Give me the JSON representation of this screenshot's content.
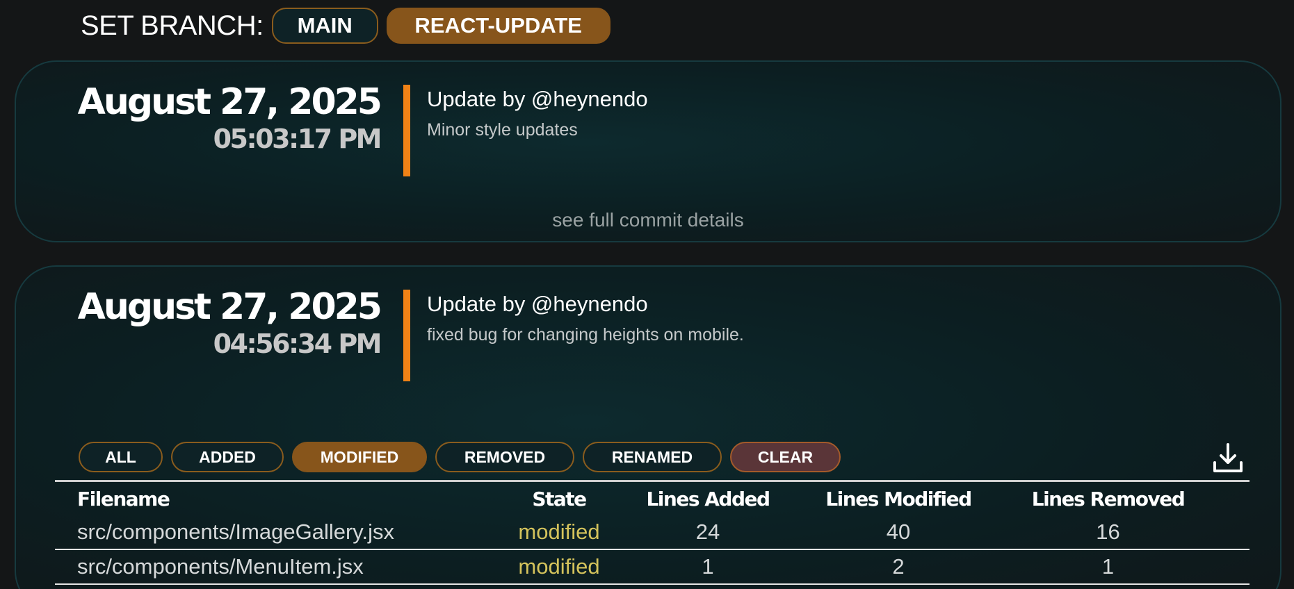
{
  "branch": {
    "label": "SET BRANCH:",
    "options": [
      "MAIN",
      "REACT-UPDATE"
    ],
    "selected": "REACT-UPDATE"
  },
  "commits": [
    {
      "date": "August 27, 2025",
      "time": "05:03:17 PM",
      "author": "Update by @heynendo",
      "message": "Minor style updates",
      "details_link": "see full commit details"
    },
    {
      "date": "August 27, 2025",
      "time": "04:56:34 PM",
      "author": "Update by @heynendo",
      "message": "fixed bug for changing heights on mobile."
    }
  ],
  "filters": {
    "all": "ALL",
    "added": "ADDED",
    "modified": "MODIFIED",
    "removed": "REMOVED",
    "renamed": "RENAMED",
    "clear": "CLEAR",
    "active": "MODIFIED"
  },
  "download_icon": "download-icon",
  "table": {
    "headers": [
      "Filename",
      "State",
      "Lines Added",
      "Lines Modified",
      "Lines Removed"
    ],
    "rows": [
      [
        "src/components/ImageGallery.jsx",
        "modified",
        "24",
        "40",
        "16"
      ],
      [
        "src/components/MenuItem.jsx",
        "modified",
        "1",
        "2",
        "1"
      ]
    ]
  },
  "colors": {
    "accent": "#f08216",
    "active_button": "#87551b",
    "state_modified": "#d4c35c",
    "card_border": "#163a3f"
  }
}
